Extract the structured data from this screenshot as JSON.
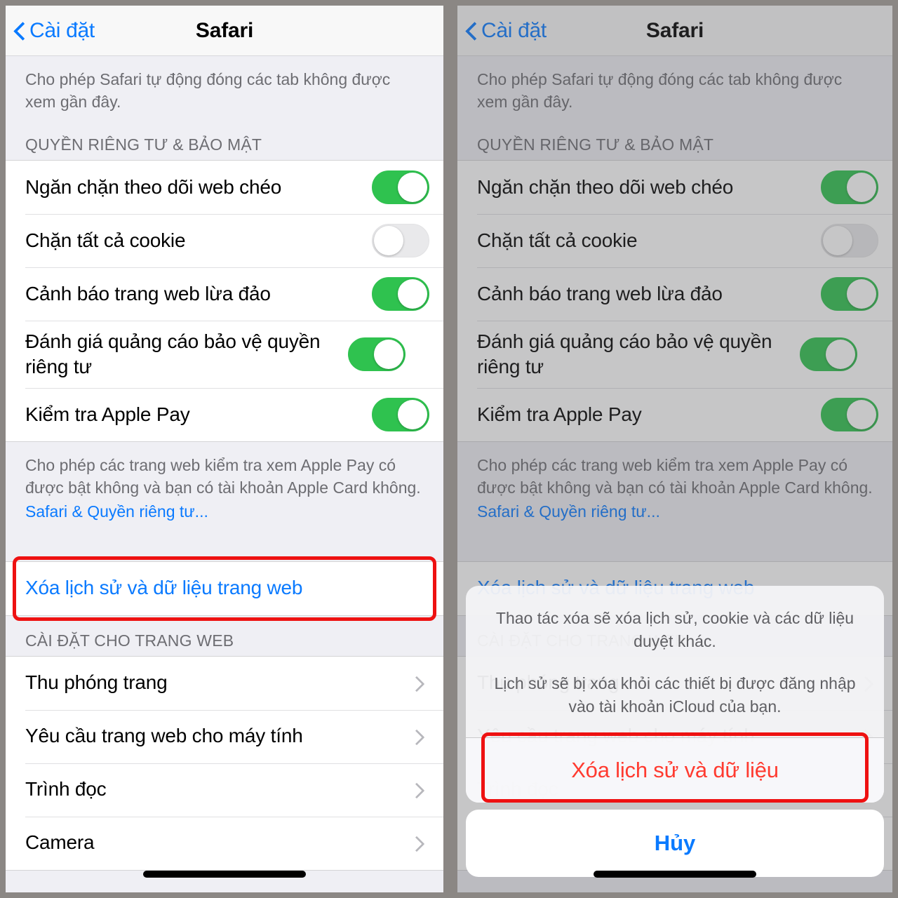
{
  "nav": {
    "back_label": "Cài đặt",
    "title": "Safari"
  },
  "top_note": "Cho phép Safari tự động đóng các tab không được xem gần đây.",
  "privacy_section": {
    "header": "QUYỀN RIÊNG TƯ & BẢO MẬT",
    "rows": [
      {
        "label": "Ngăn chặn theo dõi web chéo",
        "toggle": "on"
      },
      {
        "label": "Chặn tất cả cookie",
        "toggle": "off"
      },
      {
        "label": "Cảnh báo trang web lừa đảo",
        "toggle": "on"
      },
      {
        "label": "Đánh giá quảng cáo bảo vệ quyền riêng tư",
        "toggle": "on"
      },
      {
        "label": "Kiểm tra Apple Pay",
        "toggle": "on"
      }
    ],
    "footer_note": "Cho phép các trang web kiểm tra xem Apple Pay có được bật không và bạn có tài khoản Apple Card không.",
    "footer_link": "Safari & Quyền riêng tư..."
  },
  "clear_row": {
    "label": "Xóa lịch sử và dữ liệu trang web"
  },
  "website_section": {
    "header": "CÀI ĐẶT CHO TRANG WEB",
    "rows": [
      {
        "label": "Thu phóng trang"
      },
      {
        "label": "Yêu cầu trang web cho máy tính"
      },
      {
        "label": "Trình đọc"
      },
      {
        "label": "Camera"
      }
    ]
  },
  "action_sheet": {
    "message_line1": "Thao tác xóa sẽ xóa lịch sử, cookie và các dữ liệu duyệt khác.",
    "message_line2": "Lịch sử sẽ bị xóa khỏi các thiết bị được đăng nhập vào tài khoản iCloud của bạn.",
    "destructive_label": "Xóa lịch sử và dữ liệu",
    "cancel_label": "Hủy"
  },
  "colors": {
    "accent_blue": "#0a7aff",
    "destructive_red": "#ff3b30",
    "toggle_green": "#2fc24f",
    "highlight_red": "#ee1111",
    "frame_gray": "#8b8784"
  }
}
